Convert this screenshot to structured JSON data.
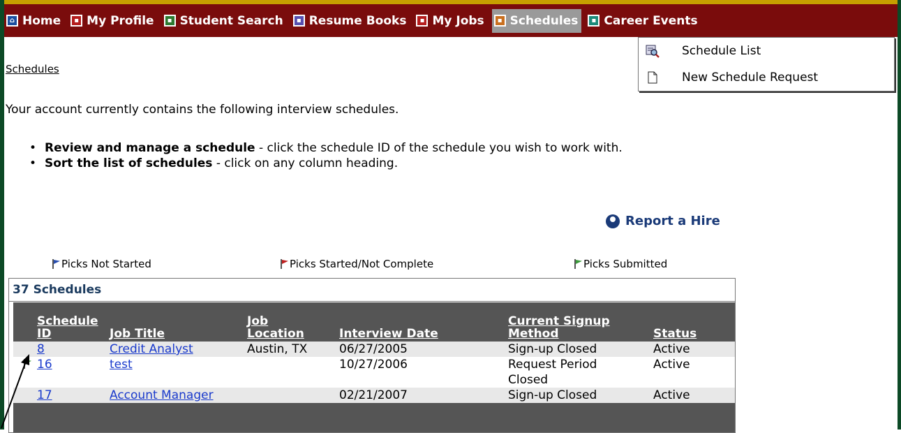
{
  "nav": {
    "items": [
      {
        "label": "Home",
        "icon": "home-icon"
      },
      {
        "label": "My Profile",
        "icon": "profile-icon"
      },
      {
        "label": "Student Search",
        "icon": "student-search-icon"
      },
      {
        "label": "Resume Books",
        "icon": "resume-books-icon"
      },
      {
        "label": "My Jobs",
        "icon": "jobs-icon"
      },
      {
        "label": "Schedules",
        "icon": "schedules-icon",
        "active": true
      },
      {
        "label": "Career Events",
        "icon": "career-events-icon"
      }
    ]
  },
  "dropdown": {
    "items": [
      {
        "label": "Schedule List",
        "icon": "magnifier-list-icon"
      },
      {
        "label": "New Schedule Request",
        "icon": "blank-page-icon"
      }
    ]
  },
  "breadcrumb": "Schedules",
  "intro": "Your account currently contains the following interview schedules.",
  "bullets": [
    {
      "bold": "Review and manage a schedule",
      "text": " - click the schedule ID of the schedule you wish to work with."
    },
    {
      "bold": "Sort the list of schedules",
      "text": " - click on any column heading."
    }
  ],
  "report_hire": "Report a Hire",
  "legend": {
    "not_started": "Picks Not Started",
    "started": "Picks Started/Not Complete",
    "submitted": "Picks Submitted"
  },
  "table": {
    "count": "37 Schedules",
    "headers": {
      "id_1": "Schedule",
      "id_2": "ID",
      "title": "Job Title",
      "loc_1": "Job",
      "loc_2": "Location",
      "date": "Interview Date",
      "method_1": "Current Signup",
      "method_2": "Method",
      "status": "Status"
    },
    "rows": [
      {
        "id": "8",
        "title": "Credit Analyst",
        "location": "Austin, TX",
        "date": "06/27/2005",
        "method_1": "Sign-up Closed",
        "method_2": "",
        "status": "Active",
        "flag": ""
      },
      {
        "id": "16",
        "title": "test",
        "location": "",
        "date": "10/27/2006",
        "method_1": "Request Period",
        "method_2": "Closed",
        "status": "Active",
        "flag": "green"
      },
      {
        "id": "17",
        "title": "Account Manager",
        "location": "",
        "date": "02/21/2007",
        "method_1": "Sign-up Closed",
        "method_2": "",
        "status": "Active",
        "flag": ""
      }
    ]
  },
  "colors": {
    "nav_bg": "#7a0c0c",
    "frame": "#0c4a26",
    "accent_bar": "#c7a000",
    "link": "#1a3acc",
    "header_bg": "#555555"
  }
}
